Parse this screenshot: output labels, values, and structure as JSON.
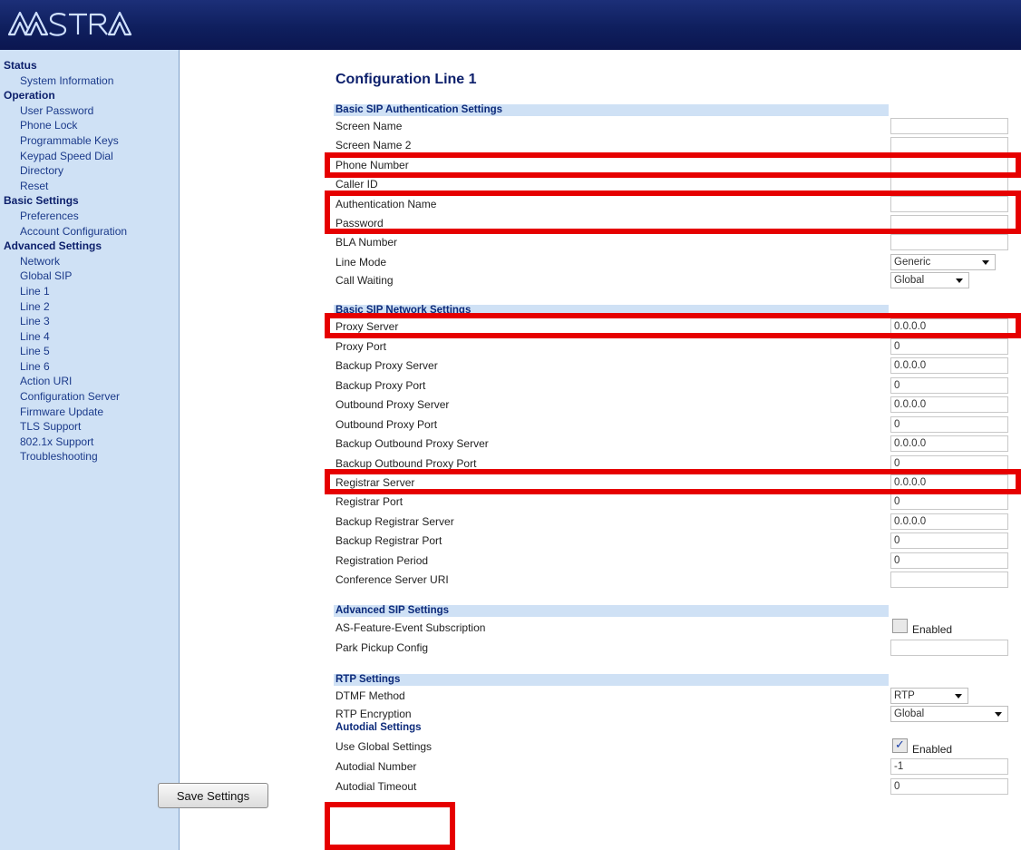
{
  "brand": {
    "logo_text": "AASTRA",
    "header_color": "#0f1f5e"
  },
  "sidebar": [
    {
      "group": "Status",
      "items": [
        "System Information"
      ]
    },
    {
      "group": "Operation",
      "items": [
        "User Password",
        "Phone Lock",
        "Programmable Keys",
        "Keypad Speed Dial",
        "Directory",
        "Reset"
      ]
    },
    {
      "group": "Basic Settings",
      "items": [
        "Preferences",
        "Account Configuration"
      ]
    },
    {
      "group": "Advanced Settings",
      "items": [
        "Network",
        "Global SIP",
        "Line 1",
        "Line 2",
        "Line 3",
        "Line 4",
        "Line 5",
        "Line 6",
        "Action URI",
        "Configuration Server",
        "Firmware Update",
        "TLS Support",
        "802.1x Support",
        "Troubleshooting"
      ]
    }
  ],
  "page_title": "Configuration Line 1",
  "sections": {
    "basic_auth": "Basic SIP Authentication Settings",
    "basic_network": "Basic SIP Network Settings",
    "advanced_sip": "Advanced SIP Settings",
    "rtp": "RTP Settings",
    "autodial": "Autodial Settings"
  },
  "fields": {
    "screen_name": {
      "label": "Screen Name",
      "value": ""
    },
    "screen_name_2": {
      "label": "Screen Name 2",
      "value": ""
    },
    "phone_number": {
      "label": "Phone Number",
      "value": ""
    },
    "caller_id": {
      "label": "Caller ID",
      "value": ""
    },
    "auth_name": {
      "label": "Authentication Name",
      "value": ""
    },
    "password": {
      "label": "Password",
      "value": ""
    },
    "bla_number": {
      "label": "BLA Number",
      "value": ""
    },
    "line_mode": {
      "label": "Line Mode",
      "value": "Generic"
    },
    "call_waiting": {
      "label": "Call Waiting",
      "value": "Global"
    },
    "proxy_server": {
      "label": "Proxy Server",
      "value": "0.0.0.0"
    },
    "proxy_port": {
      "label": "Proxy Port",
      "value": "0"
    },
    "backup_proxy_server": {
      "label": "Backup Proxy Server",
      "value": "0.0.0.0"
    },
    "backup_proxy_port": {
      "label": "Backup Proxy Port",
      "value": "0"
    },
    "outbound_proxy_server": {
      "label": "Outbound Proxy Server",
      "value": "0.0.0.0"
    },
    "outbound_proxy_port": {
      "label": "Outbound Proxy Port",
      "value": "0"
    },
    "backup_outbound_proxy_server": {
      "label": "Backup Outbound Proxy Server",
      "value": "0.0.0.0"
    },
    "backup_outbound_proxy_port": {
      "label": "Backup Outbound Proxy Port",
      "value": "0"
    },
    "registrar_server": {
      "label": "Registrar Server",
      "value": "0.0.0.0"
    },
    "registrar_port": {
      "label": "Registrar Port",
      "value": "0"
    },
    "backup_registrar_server": {
      "label": "Backup Registrar Server",
      "value": "0.0.0.0"
    },
    "backup_registrar_port": {
      "label": "Backup Registrar Port",
      "value": "0"
    },
    "registration_period": {
      "label": "Registration Period",
      "value": "0"
    },
    "conference_server_uri": {
      "label": "Conference Server URI",
      "value": ""
    },
    "as_feature_event": {
      "label": "AS-Feature-Event Subscription",
      "checkbox_label": "Enabled",
      "checked": false
    },
    "park_pickup_config": {
      "label": "Park Pickup Config",
      "value": ""
    },
    "dtmf_method": {
      "label": "DTMF Method",
      "value": "RTP"
    },
    "rtp_encryption": {
      "label": "RTP Encryption",
      "value": "Global"
    },
    "use_global_settings": {
      "label": "Use Global Settings",
      "checkbox_label": "Enabled",
      "checked": true
    },
    "autodial_number": {
      "label": "Autodial Number",
      "value": "-1"
    },
    "autodial_timeout": {
      "label": "Autodial Timeout",
      "value": "0"
    }
  },
  "save_button": "Save Settings",
  "highlight_color": "#e60000"
}
